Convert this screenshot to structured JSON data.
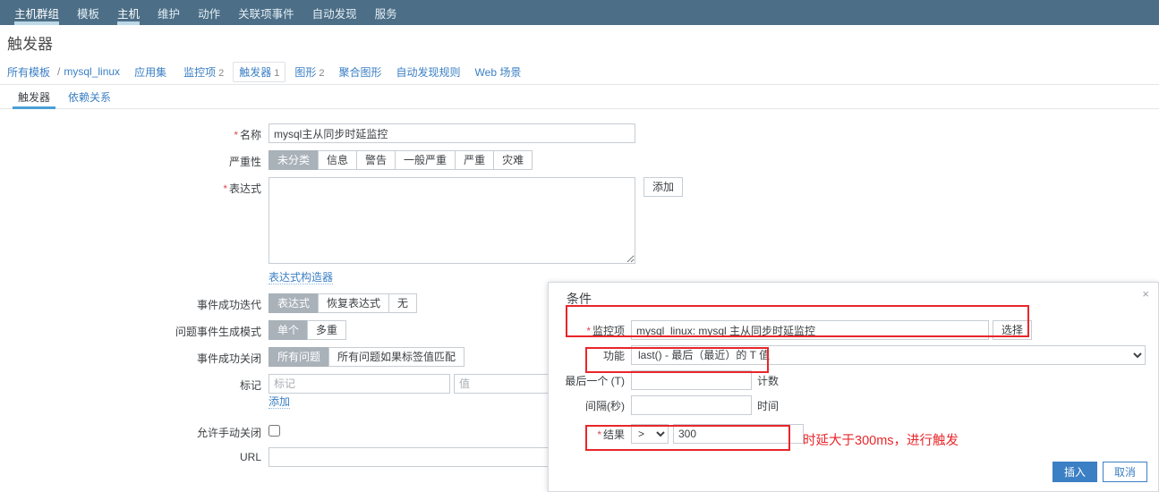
{
  "topnav": {
    "items": [
      {
        "label": "主机群组",
        "active": false
      },
      {
        "label": "模板",
        "active": false
      },
      {
        "label": "主机",
        "active": true
      },
      {
        "label": "维护",
        "active": false
      },
      {
        "label": "动作",
        "active": false
      },
      {
        "label": "关联项事件",
        "active": false
      },
      {
        "label": "自动发现",
        "active": false
      },
      {
        "label": "服务",
        "active": false
      }
    ]
  },
  "page": {
    "title": "触发器"
  },
  "breadcrumb": {
    "root": "所有模板",
    "separator": "/",
    "template": "mysql_linux",
    "items": [
      {
        "label": "应用集",
        "count": "",
        "current": false
      },
      {
        "label": "监控项",
        "count": "2",
        "current": false
      },
      {
        "label": "触发器",
        "count": "1",
        "current": true
      },
      {
        "label": "图形",
        "count": "2",
        "current": false
      },
      {
        "label": "聚合图形",
        "count": "",
        "current": false
      },
      {
        "label": "自动发现规则",
        "count": "",
        "current": false
      },
      {
        "label": "Web 场景",
        "count": "",
        "current": false
      }
    ]
  },
  "subtabs": [
    {
      "label": "触发器",
      "active": true
    },
    {
      "label": "依赖关系",
      "active": false
    }
  ],
  "form": {
    "name": {
      "label": "名称",
      "required": true,
      "value": "mysql主从同步时延监控"
    },
    "severity": {
      "label": "严重性",
      "options": [
        "未分类",
        "信息",
        "警告",
        "一般严重",
        "严重",
        "灾难"
      ],
      "selected": "未分类"
    },
    "expression": {
      "label": "表达式",
      "required": true,
      "value": "",
      "add_button": "添加",
      "constructor_link": "表达式构造器"
    },
    "event_success_iteration": {
      "label": "事件成功迭代",
      "options": [
        "表达式",
        "恢复表达式",
        "无"
      ],
      "selected": "表达式"
    },
    "problem_event_mode": {
      "label": "问题事件生成模式",
      "options": [
        "单个",
        "多重"
      ],
      "selected": "单个"
    },
    "event_close": {
      "label": "事件成功关闭",
      "options": [
        "所有问题",
        "所有问题如果标签值匹配"
      ],
      "selected": "所有问题"
    },
    "tags": {
      "label": "标记",
      "tag_placeholder": "标记",
      "value_placeholder": "值",
      "tag_value": "",
      "value_value": "",
      "add_link": "添加"
    },
    "allow_manual_close": {
      "label": "允许手动关闭",
      "checked": false
    },
    "url": {
      "label": "URL",
      "value": ""
    }
  },
  "dialog": {
    "title": "条件",
    "close_icon": "×",
    "item": {
      "label": "监控项",
      "required": true,
      "value": "mysql_linux: mysql 主从同步时延监控",
      "select_button": "选择"
    },
    "function": {
      "label": "功能",
      "value": "last() - 最后（最近）的 T 值"
    },
    "last_t": {
      "label": "最后一个 (T)",
      "value": "",
      "unit": "计数"
    },
    "interval": {
      "label": "间隔(秒)",
      "value": "",
      "unit": "时间"
    },
    "result": {
      "label": "结果",
      "required": true,
      "operator": ">",
      "value": "300"
    },
    "footer": {
      "insert": "插入",
      "cancel": "取消"
    }
  },
  "annotations": {
    "color": "#e8262a",
    "note_text": "时延大于300ms，进行触发"
  }
}
